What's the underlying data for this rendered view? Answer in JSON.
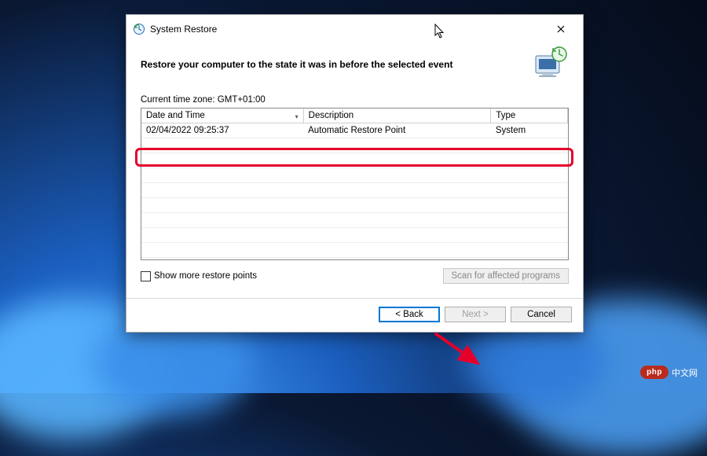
{
  "window": {
    "title": "System Restore",
    "heading": "Restore your computer to the state it was in before the selected event",
    "timezone_label": "Current time zone: GMT+01:00"
  },
  "table": {
    "columns": {
      "date": "Date and Time",
      "desc": "Description",
      "type": "Type"
    },
    "rows": [
      {
        "date": "02/04/2022 09:25:37",
        "desc": "Automatic Restore Point",
        "type": "System"
      }
    ]
  },
  "controls": {
    "show_more_label": "Show more restore points",
    "scan_label": "Scan for affected programs",
    "back_label": "< Back",
    "next_label": "Next >",
    "cancel_label": "Cancel"
  },
  "watermark": {
    "brand": "php",
    "suffix": "中文网"
  }
}
